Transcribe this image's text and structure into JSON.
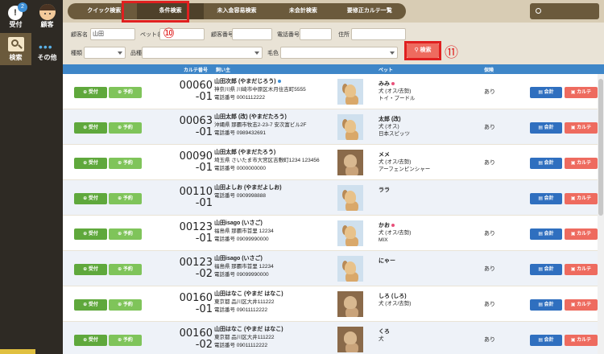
{
  "sidebar": {
    "uketsuke": {
      "label": "受付",
      "badge": "2",
      "icon": "reception-icon"
    },
    "kokyaku": {
      "label": "顧客",
      "icon": "customer-face-icon"
    },
    "kensaku": {
      "label": "検索",
      "icon": "search-icon"
    },
    "sonota": {
      "label": "その他",
      "icon": "more-dots-icon"
    }
  },
  "topnav": {
    "tabs": [
      "クイック検索",
      "条件検索",
      "未入金容易検索",
      "未会計検索",
      "要修正カルテ一覧"
    ],
    "active_tab": "条件検索"
  },
  "form": {
    "customer_name_label": "顧客名",
    "customer_name_value": "山田",
    "pet_name_label": "ペット名",
    "customer_no_label": "顧客番号",
    "phone_label": "電話番号",
    "address_label": "住所",
    "species_label": "種類",
    "breed_label": "品種",
    "color_label": "毛色",
    "search_button": "検索"
  },
  "callouts": {
    "tab": "⑩",
    "search": "⑪"
  },
  "table": {
    "headers": {
      "karte_no": "カルテ番号",
      "owner": "飼い主",
      "pet": "ペット",
      "hoken": "保険"
    },
    "rows": [
      {
        "karte1": "00060",
        "karte2": "-01",
        "owner_name": "山田次郎 (やまだじろう)",
        "owner_dot": "#3d8fd6",
        "address": "神奈川県 川崎市中原区木月住吉町5555",
        "phone": "電話番号 0001112222",
        "pet_name": "みみ",
        "pet_dot": "#e8507a",
        "pet_line1": "犬 (オス/去勢)",
        "pet_line2": "トイ・プードル",
        "hoken": "あり",
        "photo": "illust"
      },
      {
        "karte1": "00063",
        "karte2": "-01",
        "owner_name": "山田太郎 (改) (やまだたろう)",
        "owner_dot": "",
        "address": "沖縄県 那覇市牧志2-23-7 安次富ビル2F",
        "phone": "電話番号 0989432691",
        "pet_name": "太郎 (改)",
        "pet_dot": "",
        "pet_line1": "犬 (オス)",
        "pet_line2": "日本スピッツ",
        "hoken": "あり",
        "photo": "illust"
      },
      {
        "karte1": "00090",
        "karte2": "-01",
        "owner_name": "山田太郎 (やまだたろう)",
        "owner_dot": "",
        "address": "埼玉県 さいたま市大宮区吉敷町1234 123456",
        "phone": "電話番号 0000000000",
        "pet_name": "メメ",
        "pet_dot": "",
        "pet_line1": "犬 (オス/去勢)",
        "pet_line2": "アーフェンピンシャー",
        "hoken": "あり",
        "photo": "real"
      },
      {
        "karte1": "00110",
        "karte2": "-01",
        "owner_name": "山田よしお (やまだよしお)",
        "owner_dot": "",
        "address": "",
        "phone": "電話番号 0909998888",
        "pet_name": "ララ",
        "pet_dot": "",
        "pet_line1": "",
        "pet_line2": "",
        "hoken": "",
        "photo": "illust"
      },
      {
        "karte1": "00123",
        "karte2": "-01",
        "owner_name": "山田isago (いさご)",
        "owner_dot": "",
        "address": "福島県 那覇市首里 12234",
        "phone": "電話番号 09099990000",
        "pet_name": "かお",
        "pet_dot": "#e8507a",
        "pet_line1": "犬 (オス/去勢)",
        "pet_line2": "MIX",
        "hoken": "あり",
        "photo": "illust"
      },
      {
        "karte1": "00123",
        "karte2": "-02",
        "owner_name": "山田isago (いさご)",
        "owner_dot": "",
        "address": "福島県 那覇市首里 12234",
        "phone": "電話番号 09099990000",
        "pet_name": "にゃー",
        "pet_dot": "",
        "pet_line1": "",
        "pet_line2": "",
        "hoken": "あり",
        "photo": "illust"
      },
      {
        "karte1": "00160",
        "karte2": "-01",
        "owner_name": "山田はなこ (やまだ はなこ)",
        "owner_dot": "",
        "address": "東京都 品川区大井111222",
        "phone": "電話番号 09011112222",
        "pet_name": "しろ (しろ)",
        "pet_dot": "",
        "pet_line1": "犬 (オス/去勢)",
        "pet_line2": "",
        "hoken": "あり",
        "photo": "real"
      },
      {
        "karte1": "00160",
        "karte2": "-02",
        "owner_name": "山田はなこ (やまだ はなこ)",
        "owner_dot": "",
        "address": "東京都 品川区大井111222",
        "phone": "電話番号 09011112222",
        "pet_name": "くろ",
        "pet_dot": "",
        "pet_line1": "犬",
        "pet_line2": "",
        "hoken": "あり",
        "photo": "real"
      }
    ],
    "buttons": {
      "uketsuke": "受付",
      "yoyaku": "予約",
      "kaikei": "会計",
      "karte": "カルテ"
    }
  },
  "colors": {
    "blue": "#3e86c8",
    "green": "#5fa83c",
    "red": "#ee6b5f",
    "brown": "#6b5a3c"
  }
}
